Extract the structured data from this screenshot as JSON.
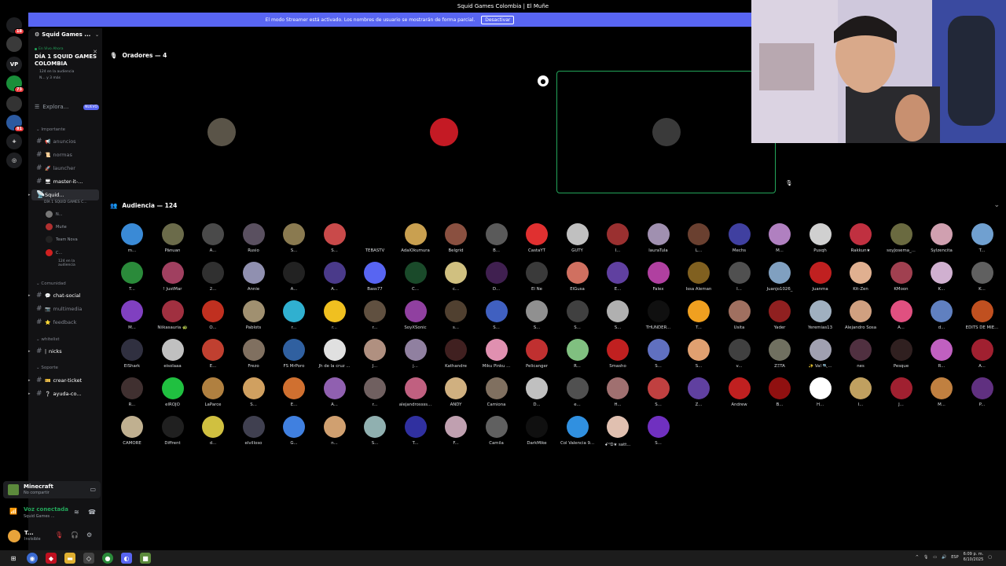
{
  "window": {
    "title": "Squid Games Colombia | El Muñe"
  },
  "banner": {
    "text": "El modo Streamer está activado. Los nombres de usuario se mostrarán de forma parcial.",
    "button": "Desactivar"
  },
  "rail": {
    "servers": [
      {
        "icon": "discord-home-icon",
        "color": "#1e1f22",
        "badge": "18"
      },
      {
        "icon": "server-icon",
        "color": "#3a3a3a",
        "badge": ""
      },
      {
        "icon": "vp-icon",
        "color": "#1e1f22",
        "label": "VP",
        "badge": ""
      },
      {
        "icon": "server-icon",
        "color": "#1a8f3a",
        "badge": "73"
      },
      {
        "icon": "server-icon",
        "color": "#333333",
        "badge": ""
      },
      {
        "icon": "server-icon",
        "color": "#2c5aa0",
        "badge": "81"
      },
      {
        "icon": "add-server-icon",
        "color": "#1e1f22",
        "label": "+",
        "badge": ""
      },
      {
        "icon": "explore-icon",
        "color": "#1e1f22",
        "label": "◎",
        "badge": ""
      }
    ]
  },
  "sidebar": {
    "server_name": "Squid Games ...",
    "event": {
      "live_label": "En Vivo Ahora",
      "title": "DÍA 1 SQUID GAMES COLOMBIA",
      "audience": "124 en la audiencia",
      "more": "N... y 3 más"
    },
    "explore": "Explora...",
    "explore_badge": "NUEVO",
    "categories": {
      "importante": "Importante",
      "comunidad": "Comunidad",
      "whitelist": "whitelist",
      "soporte": "Soporte"
    },
    "channels": {
      "anuncios": "anuncios",
      "normas": "normas",
      "launcher": "launcher",
      "master": "master-it-...",
      "stage": "Squid...",
      "stage_sub": "DÍA 1 SQUID GAMES C...",
      "chat_social": "chat-social",
      "multimedia": "multimedia",
      "feedback": "feedback",
      "nicks": "nicks",
      "crear_ticket": "crear-ticket",
      "ayuda": "ayuda-co..."
    },
    "voice_users": [
      "N...",
      "Muñe",
      "Team Nova",
      "C...",
      "124 en la audiencia"
    ]
  },
  "activity": {
    "name": "Minecraft",
    "status": "No compartir"
  },
  "voice": {
    "status": "Voz conectada",
    "channel": "Squid Games ..."
  },
  "user": {
    "name": "T...",
    "status": "Invisible"
  },
  "stage": {
    "speakers_label": "Oradores — 4",
    "audience_label": "Audiencia — 124"
  },
  "speakers": [
    {
      "color": "#8a8472"
    },
    {
      "color": "#3a2a28"
    },
    {
      "color": "#1e1f22"
    },
    {
      "color": "#e0101e"
    }
  ],
  "audience": [
    {
      "name": "m...",
      "color": "#3a8ad6"
    },
    {
      "name": "Pänuan",
      "color": "#6b6b4a"
    },
    {
      "name": "A...",
      "color": "#4a4a4a"
    },
    {
      "name": "Rusio",
      "color": "#5a5060"
    },
    {
      "name": "S...",
      "color": "#8a7a50"
    },
    {
      "name": "S...",
      "color": "#c94a4a"
    },
    {
      "name": "TEBASTV",
      "color": "#000000"
    },
    {
      "name": "AdalOkumura",
      "color": "#c9a050"
    },
    {
      "name": "Belgrid",
      "color": "#8a5040"
    },
    {
      "name": "B...",
      "color": "#5a5a5a"
    },
    {
      "name": "CastaYT",
      "color": "#e03030"
    },
    {
      "name": "GUTY",
      "color": "#c0c0c0"
    },
    {
      "name": "I...",
      "color": "#9a3030"
    },
    {
      "name": "lauraTula",
      "color": "#a090b0"
    },
    {
      "name": "L...",
      "color": "#6a4030"
    },
    {
      "name": "Mechs",
      "color": "#4040a0"
    },
    {
      "name": "M...",
      "color": "#b080c0"
    },
    {
      "name": "Puxqh",
      "color": "#d0d0d0"
    },
    {
      "name": "Rakkun★",
      "color": "#c03040"
    },
    {
      "name": "soyJosema_...",
      "color": "#6a6a40"
    },
    {
      "name": "Sylzencita",
      "color": "#d0a0b0"
    },
    {
      "name": "T...",
      "color": "#70a0d0"
    },
    {
      "name": "T...",
      "color": "#2a8a3a"
    },
    {
      "name": "! JustMar",
      "color": "#a04060"
    },
    {
      "name": "2...",
      "color": "#303030"
    },
    {
      "name": "Annie",
      "color": "#9090b0"
    },
    {
      "name": "A...",
      "color": "#222222"
    },
    {
      "name": "A...",
      "color": "#4a3a8a"
    },
    {
      "name": "Bass77",
      "color": "#5865f2"
    },
    {
      "name": "C...",
      "color": "#1a4a2a"
    },
    {
      "name": "c...",
      "color": "#d0c080"
    },
    {
      "name": "D...",
      "color": "#402050"
    },
    {
      "name": "El Ñe",
      "color": "#3a3a3a"
    },
    {
      "name": "ElGusa",
      "color": "#d07060"
    },
    {
      "name": "E...",
      "color": "#6040a0"
    },
    {
      "name": "Falex",
      "color": "#b040a0"
    },
    {
      "name": "Issa Aleman",
      "color": "#806020"
    },
    {
      "name": "I...",
      "color": "#505050"
    },
    {
      "name": "Juanjo1026_",
      "color": "#80a0c0"
    },
    {
      "name": "Juanma",
      "color": "#c02020"
    },
    {
      "name": "Kit-Zen",
      "color": "#e0b090"
    },
    {
      "name": "KMoon",
      "color": "#a04050"
    },
    {
      "name": "K...",
      "color": "#d0b0d0"
    },
    {
      "name": "K...",
      "color": "#606060"
    },
    {
      "name": "M...",
      "color": "#8040c0"
    },
    {
      "name": "Niikasauria 🐢",
      "color": "#a03040"
    },
    {
      "name": "O...",
      "color": "#c03020"
    },
    {
      "name": "Pablots",
      "color": "#a09070"
    },
    {
      "name": "r...",
      "color": "#30b0d0"
    },
    {
      "name": "r...",
      "color": "#f0c020"
    },
    {
      "name": "r...",
      "color": "#605040"
    },
    {
      "name": "SoyXSonic",
      "color": "#9040a0"
    },
    {
      "name": "s...",
      "color": "#504030"
    },
    {
      "name": "S...",
      "color": "#4060c0"
    },
    {
      "name": "S...",
      "color": "#909090"
    },
    {
      "name": "S...",
      "color": "#404040"
    },
    {
      "name": "S...",
      "color": "#b0b0b0"
    },
    {
      "name": "THUNDER...",
      "color": "#101010"
    },
    {
      "name": "T...",
      "color": "#f0a020"
    },
    {
      "name": "Usita",
      "color": "#a07060"
    },
    {
      "name": "Yader",
      "color": "#902020"
    },
    {
      "name": "Yeremias13",
      "color": "#a0b0c0"
    },
    {
      "name": "Alejandro Sosa",
      "color": "#d0a080"
    },
    {
      "name": "A...",
      "color": "#e05080"
    },
    {
      "name": "d...",
      "color": "#6080c0"
    },
    {
      "name": "EDITS DE MIE...",
      "color": "#c05020"
    },
    {
      "name": "ElShark",
      "color": "#303040"
    },
    {
      "name": "eisolaaa",
      "color": "#c0c0c0"
    },
    {
      "name": "E...",
      "color": "#c04030"
    },
    {
      "name": "Frezo",
      "color": "#807060"
    },
    {
      "name": "FS MrPoro",
      "color": "#3060a0"
    },
    {
      "name": "Jh de la cruz ...",
      "color": "#e0e0e0"
    },
    {
      "name": "J...",
      "color": "#b09080"
    },
    {
      "name": "j...",
      "color": "#9080a0"
    },
    {
      "name": "Kathandre",
      "color": "#402020"
    },
    {
      "name": "Miku Pinku ...",
      "color": "#e090b0"
    },
    {
      "name": "Pelicanger",
      "color": "#c03030"
    },
    {
      "name": "R...",
      "color": "#80c080"
    },
    {
      "name": "Smasho",
      "color": "#c02020"
    },
    {
      "name": "S...",
      "color": "#6070c0"
    },
    {
      "name": "S...",
      "color": "#e0a070"
    },
    {
      "name": "v...",
      "color": "#404040"
    },
    {
      "name": "ZΞTA",
      "color": "#707060"
    },
    {
      "name": "✨ Val 🔍...",
      "color": "#a0a0b0"
    },
    {
      "name": "nes",
      "color": "#503040"
    },
    {
      "name": "Pesque",
      "color": "#302020"
    },
    {
      "name": "R...",
      "color": "#c060c0"
    },
    {
      "name": "A...",
      "color": "#a02030"
    },
    {
      "name": "R...",
      "color": "#403030"
    },
    {
      "name": "elROJO",
      "color": "#20c040"
    },
    {
      "name": "LaParce",
      "color": "#b08040"
    },
    {
      "name": "S...",
      "color": "#d0a060"
    },
    {
      "name": "E...",
      "color": "#d07030"
    },
    {
      "name": "A...",
      "color": "#9060b0"
    },
    {
      "name": "r...",
      "color": "#706060"
    },
    {
      "name": "alejandrossss...",
      "color": "#c06080"
    },
    {
      "name": "ANDY",
      "color": "#d0b080"
    },
    {
      "name": "Camiona",
      "color": "#807060"
    },
    {
      "name": "D...",
      "color": "#c0c0c0"
    },
    {
      "name": "e...",
      "color": "#505050"
    },
    {
      "name": "H...",
      "color": "#a07070"
    },
    {
      "name": "S...",
      "color": "#c04040"
    },
    {
      "name": "Z...",
      "color": "#6040a0"
    },
    {
      "name": "Andrew",
      "color": "#c02020"
    },
    {
      "name": "B...",
      "color": "#901010"
    },
    {
      "name": "H...",
      "color": "#ffffff"
    },
    {
      "name": "I...",
      "color": "#c0a060"
    },
    {
      "name": "J...",
      "color": "#a02030"
    },
    {
      "name": "M...",
      "color": "#c08040"
    },
    {
      "name": "P...",
      "color": "#603080"
    },
    {
      "name": "CAMORE",
      "color": "#c0b090"
    },
    {
      "name": "Diffrent",
      "color": "#202020"
    },
    {
      "name": "d...",
      "color": "#d0c040"
    },
    {
      "name": "elvilloso",
      "color": "#404050"
    },
    {
      "name": "G...",
      "color": "#4080e0"
    },
    {
      "name": "n...",
      "color": "#d0a070"
    },
    {
      "name": "S...",
      "color": "#90b0b0"
    },
    {
      "name": "T...",
      "color": "#3030a0"
    },
    {
      "name": "F...",
      "color": "#c0a0b0"
    },
    {
      "name": "Camila",
      "color": "#606060"
    },
    {
      "name": "DarkMike",
      "color": "#101010"
    },
    {
      "name": "Col Valencia 9...",
      "color": "#3090e0"
    },
    {
      "name": "ꗃ꙳Ꭰ★ satt...",
      "color": "#e0c0b0"
    },
    {
      "name": "S...",
      "color": "#7030c0"
    }
  ],
  "taskbar": {
    "time": "6:09 p. m.",
    "date": "6/10/2025",
    "lang": "ESP"
  }
}
